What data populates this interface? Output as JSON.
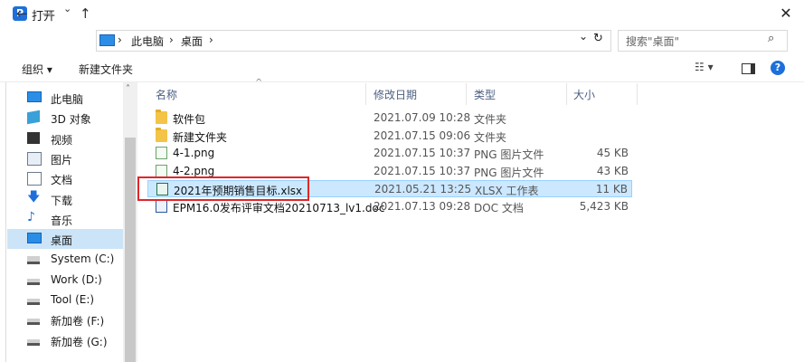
{
  "window": {
    "title": "打开",
    "app_icon_letter": "P",
    "close_glyph": "✕"
  },
  "nav": {
    "back": "←",
    "forward": "→",
    "recent": "⌄",
    "up": "↑",
    "breadcrumb": [
      "此电脑",
      "桌面"
    ],
    "sep": "›",
    "dropdown": "⌄",
    "refresh": "↻",
    "search_placeholder": "搜索\"桌面\"",
    "search_glyph": "⌕"
  },
  "commands": {
    "organize": "组织 ▾",
    "new_folder": "新建文件夹",
    "view": "☷ ▾",
    "help": "?"
  },
  "sidebar": {
    "scroll_up": "˄",
    "items": [
      {
        "label": "此电脑",
        "icon": "pc-icon"
      },
      {
        "label": "3D 对象",
        "icon": "cube-icon"
      },
      {
        "label": "视频",
        "icon": "video-icon"
      },
      {
        "label": "图片",
        "icon": "picture-icon"
      },
      {
        "label": "文档",
        "icon": "document-icon"
      },
      {
        "label": "下载",
        "icon": "download-icon"
      },
      {
        "label": "音乐",
        "icon": "music-icon"
      },
      {
        "label": "桌面",
        "icon": "desktop-icon",
        "selected": true
      },
      {
        "label": "System (C:)",
        "icon": "system-drive-icon"
      },
      {
        "label": "Work (D:)",
        "icon": "drive-icon"
      },
      {
        "label": "Tool (E:)",
        "icon": "drive-icon"
      },
      {
        "label": "新加卷 (F:)",
        "icon": "drive-icon"
      },
      {
        "label": "新加卷 (G:)",
        "icon": "drive-icon"
      }
    ]
  },
  "columns": {
    "name": "名称",
    "date": "修改日期",
    "type": "类型",
    "size": "大小",
    "sort_caret": "^"
  },
  "files": [
    {
      "name": "软件包",
      "date": "2021.07.09 10:28",
      "type": "文件夹",
      "size": "",
      "icon": "folder-icon"
    },
    {
      "name": "新建文件夹",
      "date": "2021.07.15 09:06",
      "type": "文件夹",
      "size": "",
      "icon": "folder-icon"
    },
    {
      "name": "4-1.png",
      "date": "2021.07.15 10:37",
      "type": "PNG 图片文件",
      "size": "45 KB",
      "icon": "png-file-icon"
    },
    {
      "name": "4-2.png",
      "date": "2021.07.15 10:37",
      "type": "PNG 图片文件",
      "size": "43 KB",
      "icon": "png-file-icon"
    },
    {
      "name": "2021年预期销售目标.xlsx",
      "date": "2021.05.21 13:25",
      "type": "XLSX 工作表",
      "size": "11 KB",
      "icon": "xlsx-file-icon",
      "selected": true
    },
    {
      "name": "EPM16.0发布评审文档20210713_lv1.doc",
      "date": "2021.07.13 09:28",
      "type": "DOC 文档",
      "size": "5,423 KB",
      "icon": "doc-file-icon"
    }
  ],
  "colors": {
    "selection": "#cce8ff",
    "highlight_box": "#e0262a",
    "accent": "#1e6fd9"
  }
}
